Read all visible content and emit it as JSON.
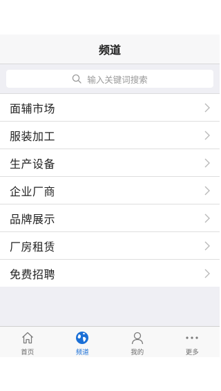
{
  "nav": {
    "title": "频道"
  },
  "search": {
    "placeholder": "输入关键词搜索"
  },
  "channels": [
    {
      "label": "面辅市场"
    },
    {
      "label": "服装加工"
    },
    {
      "label": "生产设备"
    },
    {
      "label": "企业厂商"
    },
    {
      "label": "品牌展示"
    },
    {
      "label": "厂房租赁"
    },
    {
      "label": "免费招聘"
    }
  ],
  "tabs": [
    {
      "label": "首页",
      "icon": "home-icon"
    },
    {
      "label": "频道",
      "icon": "globe-icon",
      "active": true
    },
    {
      "label": "我的",
      "icon": "user-icon"
    },
    {
      "label": "更多",
      "icon": "more-icon"
    }
  ],
  "colors": {
    "accent": "#1a6fd6",
    "background": "#efeff4"
  }
}
